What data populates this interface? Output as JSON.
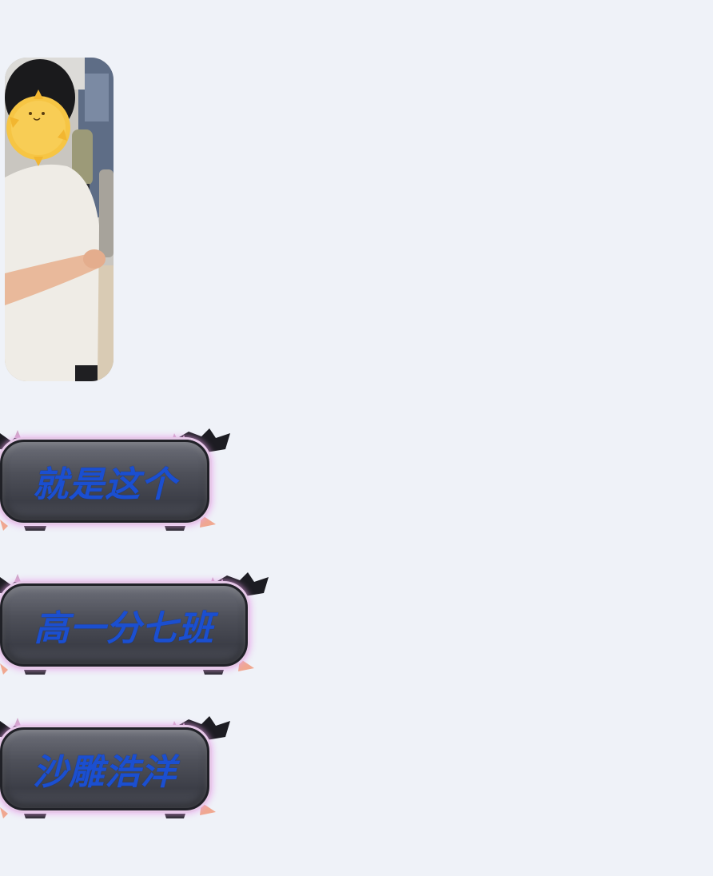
{
  "messages": [
    {
      "type": "image",
      "description_icon": "photo-thumbnail"
    },
    {
      "type": "text",
      "text": "就是这个"
    },
    {
      "type": "text",
      "text": "高一分七班"
    },
    {
      "type": "text",
      "text": "沙雕浩洋"
    }
  ],
  "colors": {
    "background": "#eff2f8",
    "bubble_text": "#1b4fd0",
    "bubble_fill": "#4e5059",
    "bubble_glow": "#e6c8e8"
  }
}
